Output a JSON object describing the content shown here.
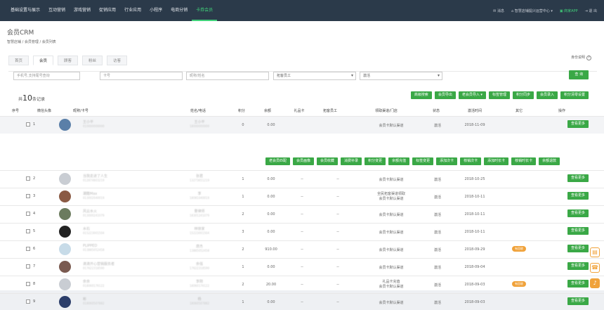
{
  "nav": {
    "items": [
      "基础设置与展示",
      "互动营销",
      "游戏营销",
      "促销应用",
      "行业应用",
      "小程序",
      "电商分销",
      "卡券会员"
    ],
    "active_index": 7,
    "right": {
      "msg": "消息",
      "store": "智慧店铺提兴运营中心",
      "app": "商家APP",
      "logout": "退 出"
    }
  },
  "page": {
    "title": "会员CRM",
    "breadcrumb": "智慧店铺  /  会员管理  /  会员列表",
    "help": "身份说明"
  },
  "tabs": [
    "首页",
    "会员",
    "顾客",
    "粉丝",
    "访客"
  ],
  "active_tab": 1,
  "filters": {
    "phone_placeholder": "手机号,支持尾号查询",
    "card_placeholder": "卡号",
    "nick_placeholder": "昵称/姓名",
    "staff": "拓客员工",
    "status": "激活",
    "query": "查 询"
  },
  "summary": {
    "prefix": "共",
    "count": "10",
    "suffix": "条记录"
  },
  "actions": [
    "高级搜索",
    "会员导出",
    "老会员导入 ▾",
    "标签管理",
    "积分同步",
    "会员录入",
    "积分清零设置"
  ],
  "columns": [
    "序号",
    "微信头像",
    "昵称/卡号",
    "姓名/电话",
    "积分",
    "余额",
    "礼品卡",
    "拓客员工",
    "领取渠道/门店",
    "状态",
    "激活时间",
    "其它",
    "操作"
  ],
  "bulk": [
    "老会员匹配",
    "会员画像",
    "会员收藏",
    "消费补录",
    "积分变更",
    "余额充值",
    "标签变更",
    "添加次卡",
    "核销次卡",
    "添加时长卡",
    "核销时长卡",
    "余额退款"
  ],
  "more_label": "查看更多",
  "rows": [
    {
      "no": "1",
      "nick": "王小平",
      "card": "010000000000",
      "name": "王小平",
      "phone": "18000000000",
      "points": "0",
      "balance": "0.00",
      "gift": "",
      "staff": "",
      "channel": "会员卡默认渠道",
      "status": "激活",
      "time": "2018-11-09",
      "other": "",
      "avatar": "#5a7fa8"
    },
    {
      "no": "2",
      "nick": "当我走进了人生",
      "card": "012874803219",
      "name": "张君",
      "phone": "13273651219",
      "points": "1",
      "balance": "0.00",
      "gift": "--",
      "staff": "--",
      "channel": "会员卡默认渠道",
      "status": "激活",
      "time": "2018-10-25",
      "other": "",
      "avatar": "#c9cdd3"
    },
    {
      "no": "3",
      "nick": "潮酷Max",
      "card": "013002040019",
      "name": "李",
      "phone": "18081040019",
      "points": "1",
      "balance": "0.00",
      "gift": "--",
      "staff": "--",
      "channel": "全民拓客渠道领取",
      "channel2": "会员卡默认渠道",
      "status": "激活",
      "time": "2018-10-11",
      "other": "",
      "avatar": "#8a5a44"
    },
    {
      "no": "4",
      "nick": "风云水火",
      "card": "013000241079",
      "name": "曹律师",
      "phone": "18301241079",
      "points": "2",
      "balance": "0.00",
      "gift": "--",
      "staff": "--",
      "channel": "会员卡默认渠道",
      "status": "激活",
      "time": "2018-10-11",
      "other": "",
      "avatar": "#6b7b5e"
    },
    {
      "no": "5",
      "nick": "水石",
      "card": "015223001504",
      "name": "林徐家",
      "phone": "15223001504",
      "points": "3",
      "balance": "0.00",
      "gift": "--",
      "staff": "--",
      "channel": "会员卡默认渠道",
      "status": "激活",
      "time": "2018-10-11",
      "other": "",
      "avatar": "#222222"
    },
    {
      "no": "6",
      "nick": "PLIPPED",
      "card": "013885052458",
      "name": "唐杰",
      "phone": "13885052458",
      "points": "2",
      "balance": "910.00",
      "gift": "--",
      "staff": "--",
      "channel": "会员卡默认渠道",
      "status": "激活",
      "time": "2018-09-29",
      "other": "有回收",
      "avatar": "#c7dbe8"
    },
    {
      "no": "7",
      "nick": "滴滴开心营销服务者",
      "card": "017622318590",
      "name": "余强",
      "phone": "17622318590",
      "points": "1",
      "balance": "0.00",
      "gift": "--",
      "staff": "--",
      "channel": "会员卡默认渠道",
      "status": "激活",
      "time": "2018-09-04",
      "other": "",
      "avatar": "#7a5a50"
    },
    {
      "no": "8",
      "nick": "余余",
      "card": "018060176122",
      "name": "李刚",
      "phone": "18060176122",
      "points": "2",
      "balance": "20.00",
      "gift": "--",
      "staff": "--",
      "channel": "礼品卡充值",
      "channel2": "会员卡默认渠道",
      "status": "激活",
      "time": "2018-09-03",
      "other": "有回收",
      "avatar": "#c9cdd3"
    },
    {
      "no": "9",
      "nick": "彬",
      "card": "018060507882",
      "name": "杨",
      "phone": "18060507882",
      "points": "1",
      "balance": "0.00",
      "gift": "--",
      "staff": "--",
      "channel": "会员卡默认渠道",
      "status": "激活",
      "time": "2018-09-03",
      "other": "",
      "avatar": "#2c3e6a"
    }
  ]
}
